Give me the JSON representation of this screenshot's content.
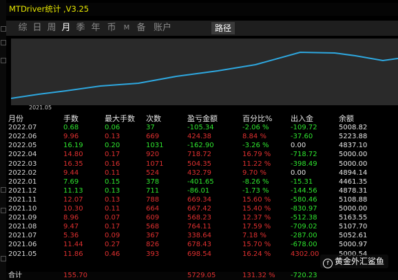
{
  "window": {
    "title": "MTDriver统计 ,V3.25"
  },
  "menu": {
    "items": [
      "综",
      "日",
      "周",
      "月",
      "季",
      "年",
      "币",
      "M",
      "备",
      "账户"
    ],
    "active_index": 3,
    "path_button": "路径"
  },
  "chart": {
    "start_label": "2021.05",
    "line_color": "#2ea8e0"
  },
  "table": {
    "headers": [
      "月份",
      "手数",
      "最大手数",
      "次数",
      "盈亏金额",
      "百分比%",
      "出入金",
      "余额"
    ],
    "rows": [
      [
        "2022.07",
        "0.68",
        "0.06",
        "37",
        "-105.34",
        "-2.06 %",
        "-109.72",
        "5008.82"
      ],
      [
        "2022.06",
        "9.96",
        "0.13",
        "669",
        "424.38",
        "8.84 %",
        "-37.60",
        "5223.88"
      ],
      [
        "2022.05",
        "16.19",
        "0.20",
        "1031",
        "-162.90",
        "-3.26 %",
        "0.00",
        "4837.10"
      ],
      [
        "2022.04",
        "14.80",
        "0.17",
        "920",
        "718.72",
        "16.79 %",
        "-718.72",
        "5000.00"
      ],
      [
        "2022.03",
        "16.35",
        "0.16",
        "1071",
        "504.35",
        "11.22 %",
        "-398.49",
        "5000.00"
      ],
      [
        "2022.02",
        "9.44",
        "0.11",
        "524",
        "432.79",
        "9.70 %",
        "0.00",
        "4894.14"
      ],
      [
        "2022.01",
        "7.69",
        "0.15",
        "378",
        "-401.65",
        "-8.26 %",
        "-15.31",
        "4461.35"
      ],
      [
        "2021.12",
        "11.13",
        "0.13",
        "711",
        "-86.01",
        "-1.73 %",
        "-144.56",
        "4878.31"
      ],
      [
        "2021.11",
        "12.07",
        "0.13",
        "788",
        "669.34",
        "15.60 %",
        "-580.46",
        "5108.88"
      ],
      [
        "2021.10",
        "10.30",
        "0.11",
        "664",
        "667.42",
        "15.40 %",
        "-830.97",
        "5000.00"
      ],
      [
        "2021.09",
        "8.96",
        "0.07",
        "609",
        "568.23",
        "12.37 %",
        "-512.38",
        "5163.55"
      ],
      [
        "2021.08",
        "9.47",
        "0.17",
        "568",
        "764.11",
        "17.59 %",
        "-709.02",
        "5107.70"
      ],
      [
        "2021.07",
        "5.36",
        "0.09",
        "367",
        "338.64",
        "7.18 %",
        "-287.00",
        "5052.61"
      ],
      [
        "2021.06",
        "11.44",
        "0.27",
        "826",
        "678.43",
        "15.70 %",
        "-678.00",
        "5000.97"
      ],
      [
        "2021.05",
        "11.86",
        "0.46",
        "393",
        "698.54",
        "16.24 %",
        "4302.00",
        "5000.54"
      ]
    ],
    "row_colors": [
      "green",
      "red",
      "green",
      "red",
      "red",
      "red",
      "green",
      "green",
      "red",
      "red",
      "red",
      "red",
      "red",
      "red",
      "red"
    ],
    "total": {
      "label": "合计",
      "lots": "155.70",
      "profit": "5729.05",
      "percent": "131.32 %",
      "flow": "-720.23"
    }
  },
  "colors": {
    "green": "#2fe52f",
    "red": "#e03030",
    "header_text": "#e6e6e6",
    "date_text": "#d8d8d8",
    "neutral_text": "#e6e6e6"
  },
  "watermark": {
    "text": "黄金外汇鲨鱼"
  }
}
